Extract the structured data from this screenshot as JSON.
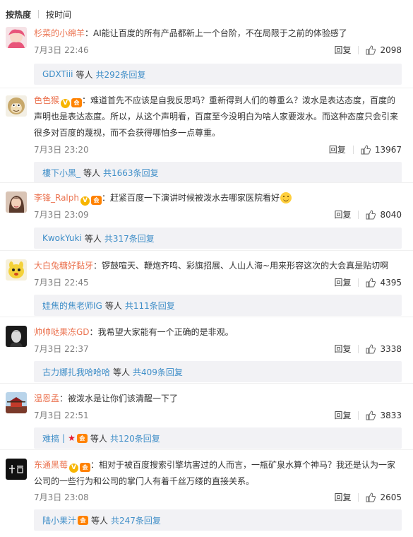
{
  "sort": {
    "hot": "按热度",
    "time": "按时间"
  },
  "actions": {
    "reply": "回复"
  },
  "comments": [
    {
      "user": "杉菜的小绵羊",
      "text": "AI能让百度的所有产品都新上一个台阶，不在局限于之前的体验感了",
      "time": "7月3日 22:46",
      "likes": "2098",
      "reply_user": "GDXTiii",
      "reply_mid": "等人",
      "reply_total": "共292条回复"
    },
    {
      "user": "色色猴",
      "text": "难道首先不应该是自我反思吗？重新得到人们的尊重么？泼水是表达态度，百度的声明也是表达态度。所以，从这个声明看，百度至今没明白为啥人家要泼水。而这种态度只会引来很多对百度的蔑视，而不会获得哪怕多一点尊重。",
      "text_l1": "难道首先不应该是自我反思吗？重新得到人们的尊重么？泼水是表达态度，百度的",
      "text_l2": "声明也是表达态度。所以，从这个声明看，百度至今没明白为啥人家要泼水。而这种态度只会引来",
      "text_l3": "很多对百度的蔑视，而不会获得哪怕多一点尊重。",
      "time": "7月3日 23:20",
      "likes": "13967",
      "reply_user": "樓下小黑_",
      "reply_mid": "等人",
      "reply_total": "共1663条回复"
    },
    {
      "user": "李锋_Ralph",
      "text": "赶紧百度一下演讲时候被泼水去哪家医院看好",
      "time": "7月3日 23:09",
      "likes": "8040",
      "reply_user": "KwokYuki",
      "reply_mid": "等人",
      "reply_total": "共317条回复"
    },
    {
      "user": "大白兔糖好黏牙",
      "text": "锣鼓喧天、鞭炮齐鸣、彩旗招展、人山人海~用来形容这次的大会真是贴切啊",
      "time": "7月3日 22:45",
      "likes": "4395",
      "reply_user": "娃焦的焦老师IG",
      "reply_mid": "等人",
      "reply_total": "共111条回复"
    },
    {
      "user": "帅帅哒果冻GD",
      "text": "我希望大家能有一个正确的是非观。",
      "time": "7月3日 22:37",
      "likes": "3338",
      "reply_user": "古力娜扎我哈哈哈",
      "reply_mid": "等人",
      "reply_total": "共409条回复"
    },
    {
      "user": "温恩孟",
      "text": "被泼水是让你们该清醒一下了",
      "time": "7月3日 22:51",
      "likes": "3833",
      "reply_user": "难搞",
      "reply_bar": "|",
      "reply_mid": "等人",
      "reply_total": "共120条回复"
    },
    {
      "user": "东通黑莓",
      "text_l1": "相对于被百度搜索引擎坑害过的人而言，一瓶矿泉水算个神马？我还是认为一家",
      "text_l2": "公司的一些行为和公司的掌门人有着千丝万缕的直接关系。",
      "time": "7月3日 23:08",
      "likes": "2605",
      "reply_user": "陆小果汁",
      "reply_mid": "等人",
      "reply_total": "共247条回复"
    }
  ],
  "colors": {
    "username": "#eb7350",
    "link": "#3f8ec8",
    "reply_bg": "#f2f2f5",
    "time": "#808080"
  }
}
